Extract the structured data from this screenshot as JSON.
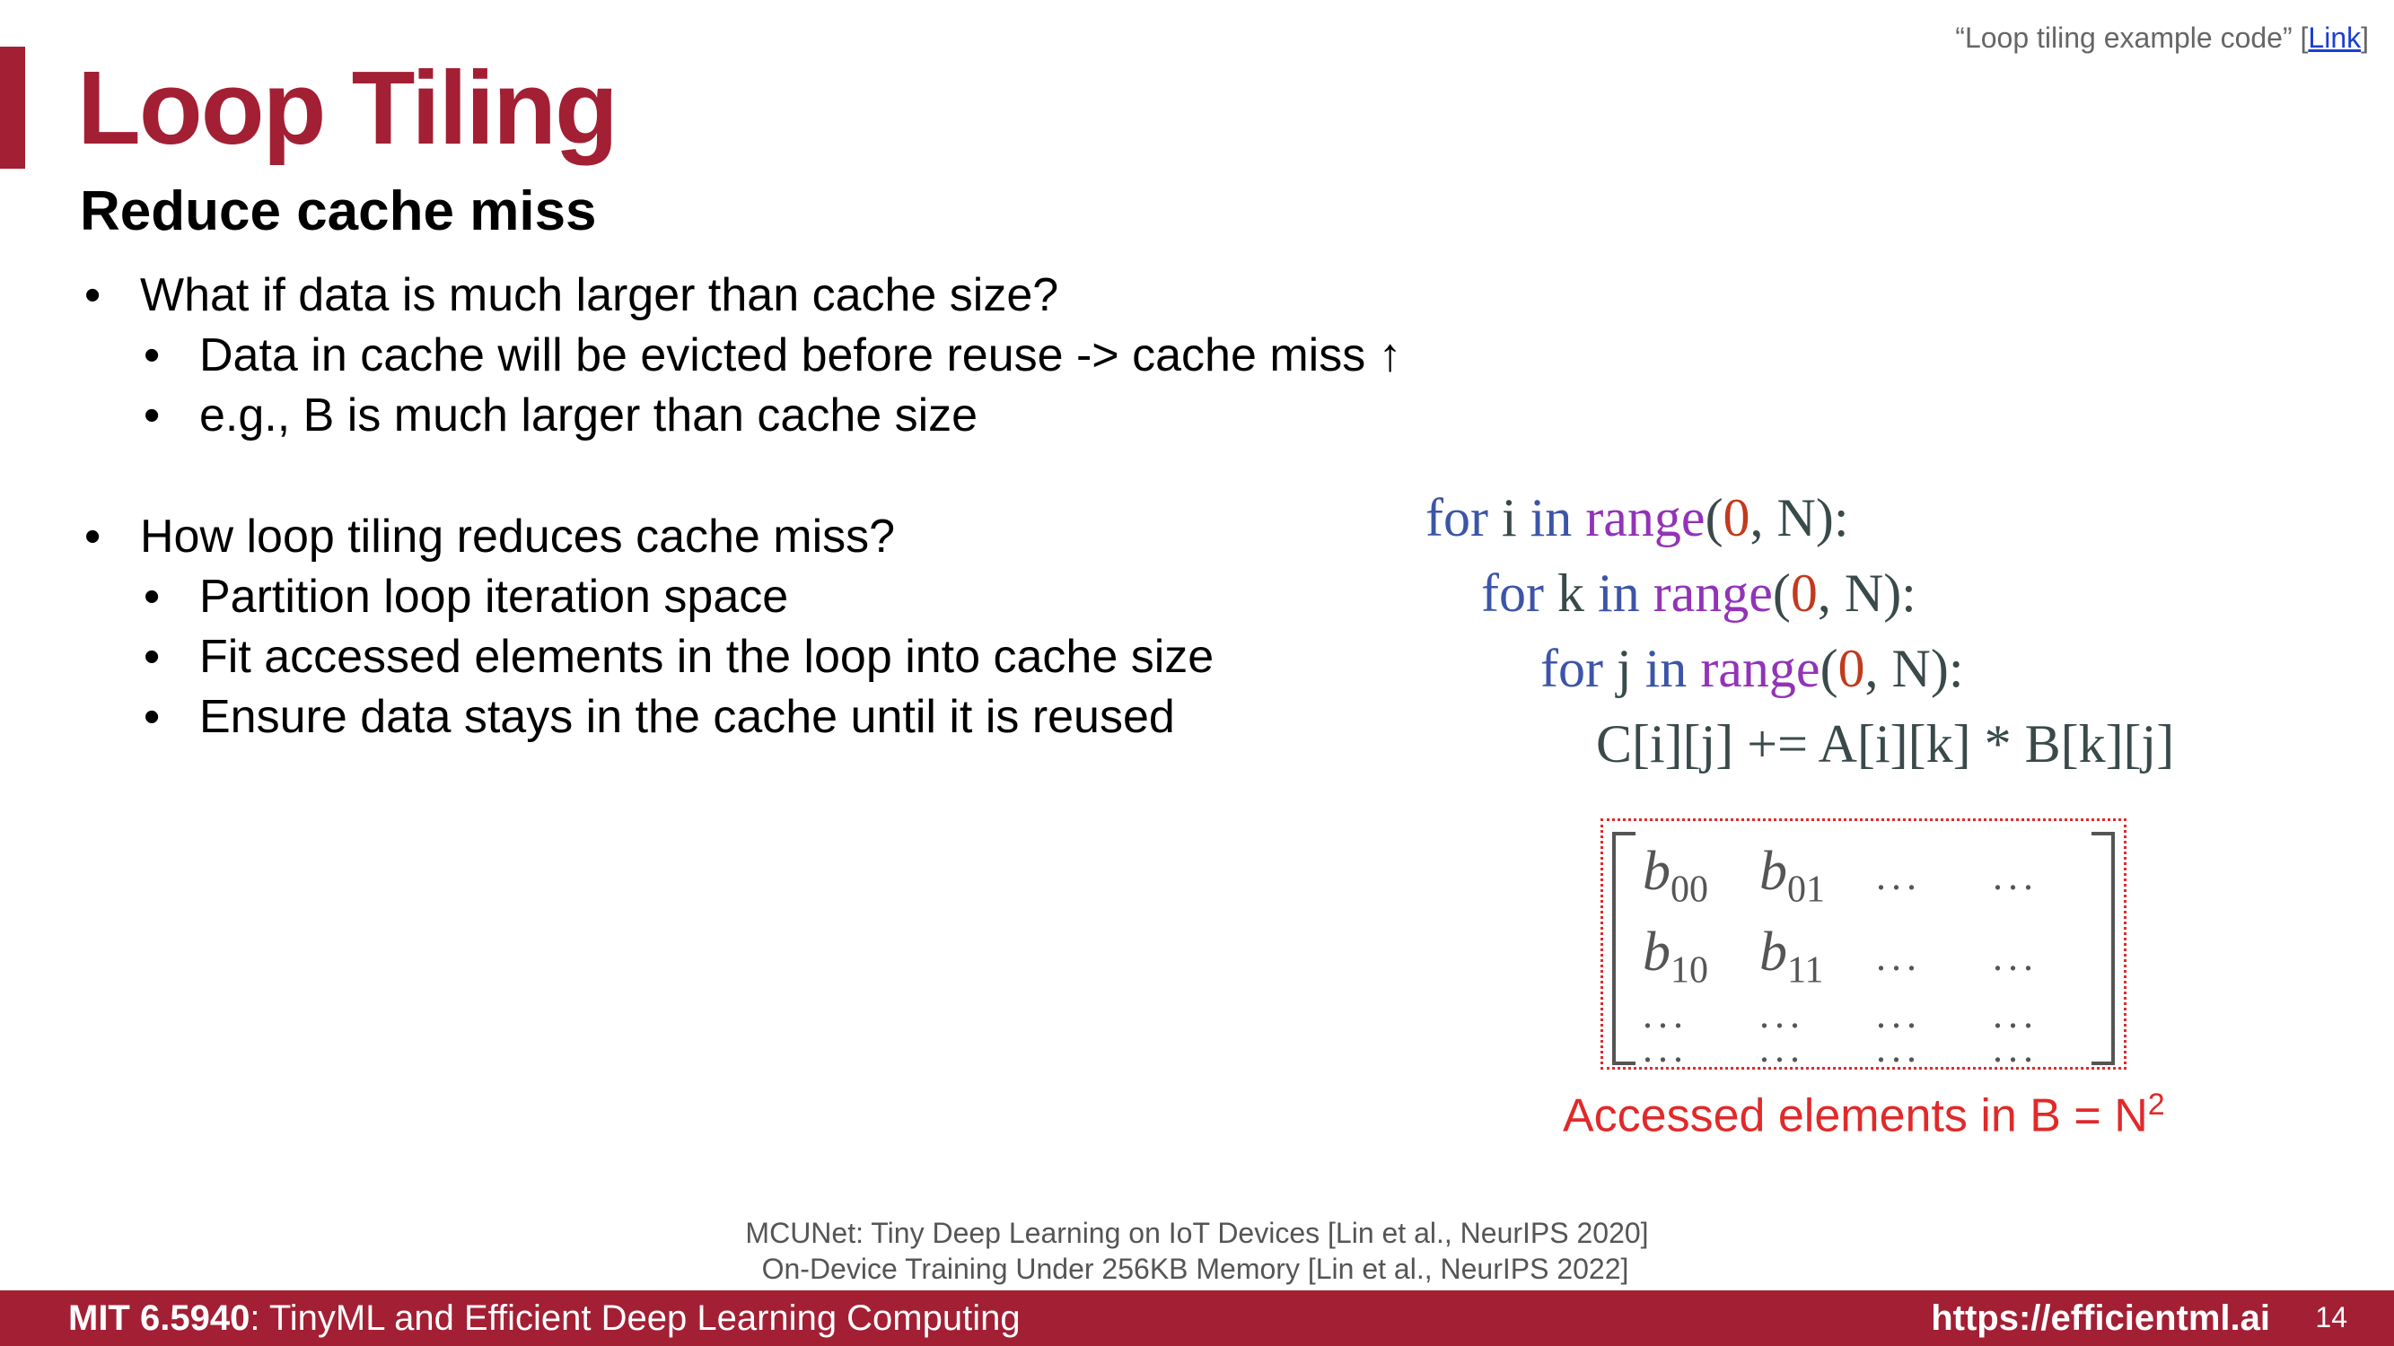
{
  "header": {
    "title": "Loop Tiling",
    "subtitle": "Reduce cache miss",
    "reference": {
      "prefix": "“Loop tiling example code” [",
      "link_label": "Link",
      "suffix": "]"
    }
  },
  "bullets": {
    "q1": "What if data is much larger than cache size?",
    "q1_sub1": "Data in cache will be evicted before reuse -> cache miss ↑",
    "q1_sub2": "e.g., B is much larger than cache size",
    "q2": "How loop tiling reduces cache miss?",
    "q2_sub1": "Partition loop iteration space",
    "q2_sub2": "Fit accessed elements in the loop into cache size",
    "q2_sub3": "Ensure data stays in the cache until it is reused"
  },
  "code": {
    "kw_for": "for",
    "kw_in": "in",
    "fn_range": "range",
    "zero": "0",
    "var_i": " i ",
    "var_k": " k ",
    "var_j": " j ",
    "open_paren": "(",
    "args_tail": ", N):",
    "statement": "C[i][j] += A[i][k] * B[k][j]"
  },
  "matrix": {
    "base": "b",
    "dots": "...",
    "rows": [
      [
        "00",
        "01"
      ],
      [
        "10",
        "11"
      ]
    ]
  },
  "caption": {
    "text": "Accessed elements in B = N",
    "exponent": "2"
  },
  "citations": {
    "line1": "MCUNet: Tiny Deep Learning on IoT Devices [Lin et al., NeurIPS 2020]",
    "line2": "On-Device Training Under 256KB Memory [Lin et al., NeurIPS 2022]"
  },
  "footer": {
    "course_code": "MIT 6.5940",
    "course_title": ": TinyML and Efficient Deep Learning Computing",
    "website": "https://efficientml.ai",
    "page": "14"
  },
  "colors": {
    "brand": "#a31f34",
    "keyword": "#3c55a8",
    "function": "#9233b8",
    "number": "#c23a1f",
    "highlight": "#e02a2a"
  }
}
